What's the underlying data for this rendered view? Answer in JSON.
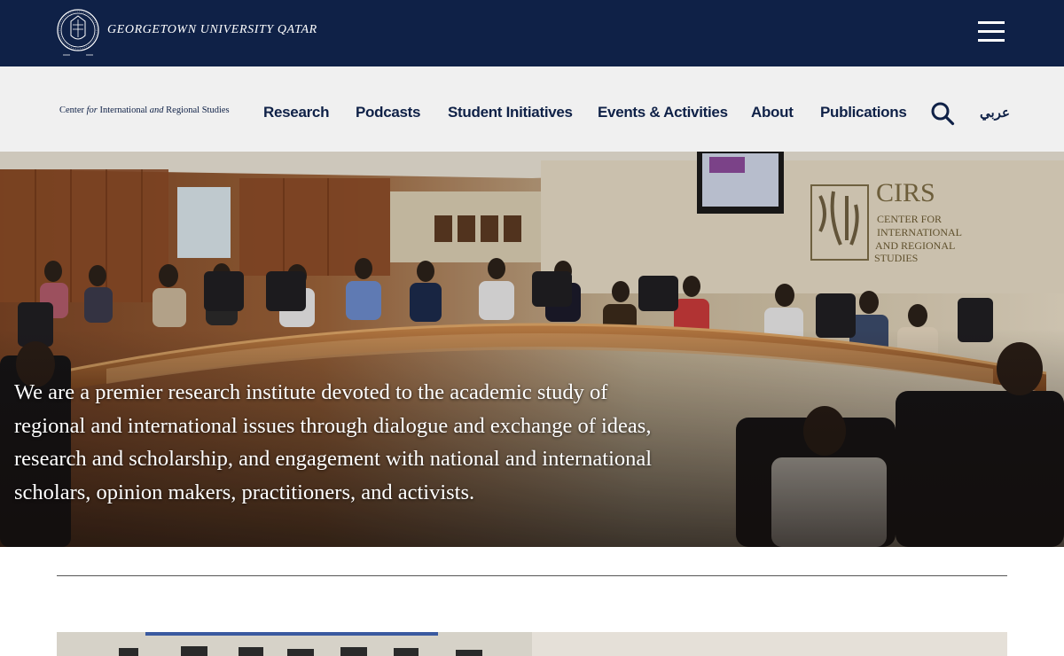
{
  "header": {
    "university_name": "GEORGETOWN UNIVERSITY QATAR",
    "seal_icon": "university-seal-icon",
    "menu_icon": "hamburger-menu-icon"
  },
  "nav": {
    "logo_part1": "Center ",
    "logo_for": "for",
    "logo_part2": " International ",
    "logo_and": "and",
    "logo_part3": " Regional Studies",
    "items": [
      {
        "label": "Research"
      },
      {
        "label": "Podcasts"
      },
      {
        "label": "Student Initiatives"
      },
      {
        "label": "Events & Activities"
      },
      {
        "label": "About"
      },
      {
        "label": "Publications"
      }
    ],
    "search_icon": "search-icon",
    "language_label": "عربي"
  },
  "hero": {
    "sign_title": "CIRS",
    "sign_line1": "CENTER FOR",
    "sign_line2": "INTERNATIONAL",
    "sign_line3": "AND REGIONAL",
    "sign_line4": "STUDIES",
    "mission_line1": "We are a premier research institute devoted to the academic study of",
    "mission_line2": "regional and international issues through dialogue and exchange of ideas,",
    "mission_line3": "research and scholarship, and engagement with national and international",
    "mission_line4": "scholars, opinion makers, practitioners, and activists."
  },
  "colors": {
    "navy": "#0f2147",
    "nav_bg": "#f0f0f0",
    "gold": "#b8a06a"
  }
}
